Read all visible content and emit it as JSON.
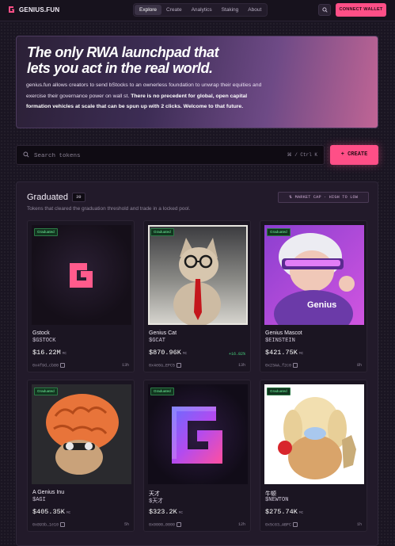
{
  "header": {
    "logo_text": "GENIUS.FUN",
    "nav": [
      {
        "label": "Explore",
        "active": true
      },
      {
        "label": "Create",
        "active": false
      },
      {
        "label": "Analytics",
        "active": false
      },
      {
        "label": "Staking",
        "active": false
      },
      {
        "label": "About",
        "active": false
      }
    ],
    "search_icon": "search-icon",
    "connect_label": "CONNECT WALLET"
  },
  "hero": {
    "title_line1": "The only RWA launchpad that",
    "title_line2": "lets you act in the real world.",
    "desc_part1": "genius.fun allows creators to send bStocks to an ownerless foundation to unwrap their equities and exercise their governance power on wall st.",
    "desc_bold": "There is no precedent for global, open capital formation vehicles at scale that can be spun up with 2 clicks. Welcome to that future."
  },
  "search": {
    "placeholder": "Search tokens",
    "shortcut": "⌘ / Ctrl K",
    "create_label": "+ CREATE"
  },
  "graduated": {
    "title": "Graduated",
    "count": "39",
    "subtitle": "Tokens that cleared the graduation threshold and trade in a locked pool.",
    "sort_label": "⇅ MARKET CAP · HIGH TO LOW",
    "badge_label": "Graduated",
    "mc_unit": "MC",
    "tokens": [
      {
        "name": "Gstock",
        "symbol": "$GSTOCK",
        "mc": "$16.22M",
        "change": "",
        "addr": "0x4f9d…cb80",
        "time": "13h"
      },
      {
        "name": "Genius Cat",
        "symbol": "$GCAT",
        "mc": "$870.96K",
        "change": "+16.82%",
        "addr": "0x4e0a…EFC5",
        "time": "13h"
      },
      {
        "name": "Genius Mascot",
        "symbol": "$EINSTEIN",
        "mc": "$421.75K",
        "change": "",
        "addr": "0x23AA…f2c0",
        "time": "8h"
      },
      {
        "name": "A Genius Inu",
        "symbol": "$AGI",
        "mc": "$405.35K",
        "change": "",
        "addr": "0x893b…1e10",
        "time": "5h"
      },
      {
        "name": "天才",
        "symbol": "$天才",
        "mc": "$323.2K",
        "change": "",
        "addr": "0x0000…0000",
        "time": "12h"
      },
      {
        "name": "牛顿",
        "symbol": "$NEWTON",
        "mc": "$275.74K",
        "change": "",
        "addr": "0x5c63…ABFC",
        "time": "1h"
      }
    ]
  }
}
